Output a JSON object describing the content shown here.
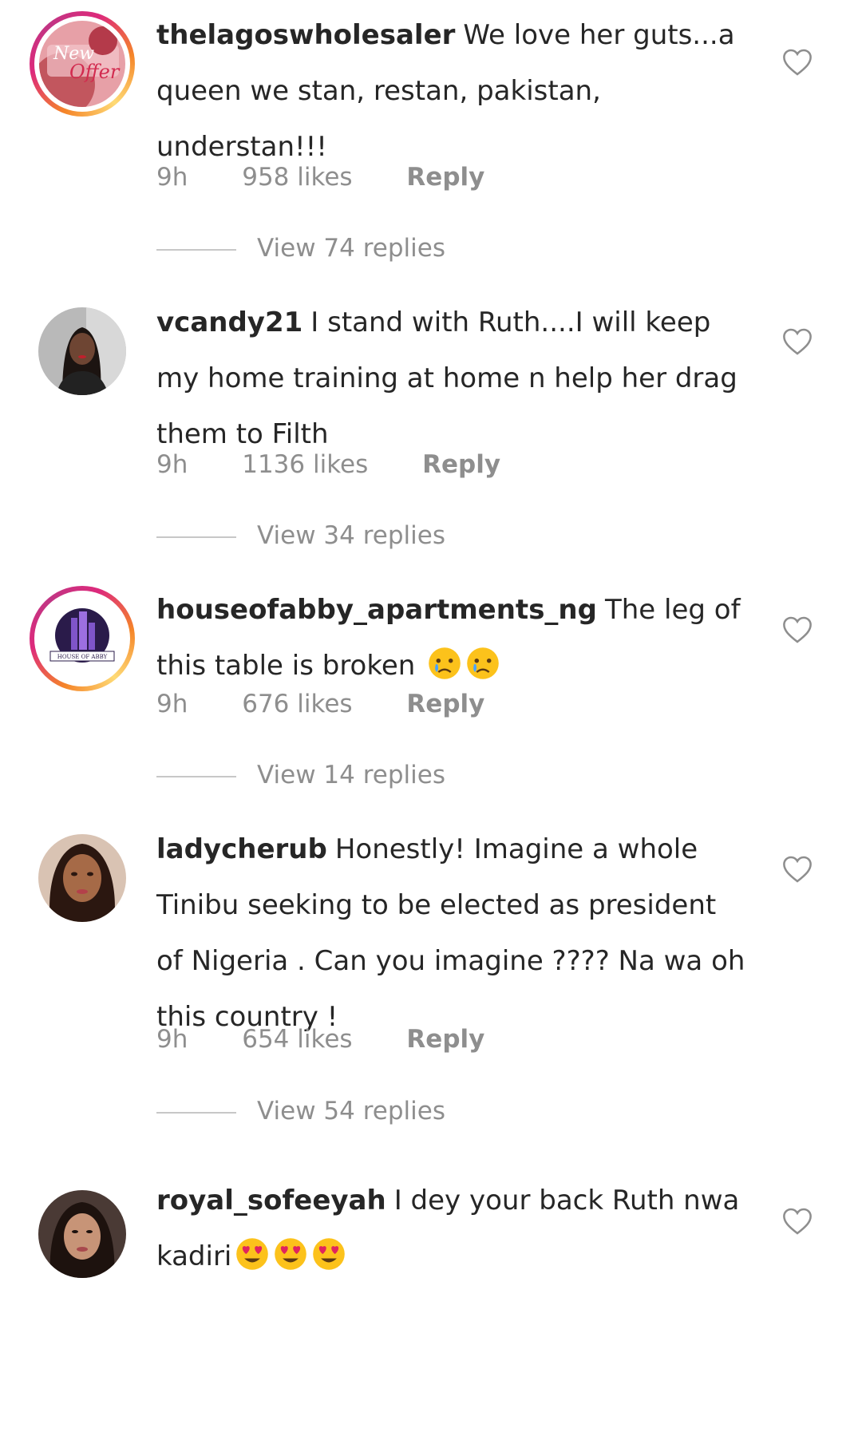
{
  "comments": [
    {
      "username": "thelagoswholesaler",
      "text": "We love her guts...a queen we stan, restan, pakistan, understan!!!",
      "time": "9h",
      "likes": "958 likes",
      "reply": "Reply",
      "view_replies": "View 74 replies"
    },
    {
      "username": "vcandy21",
      "text": "I stand with Ruth....I will keep my home training at home n help her drag them to Filth",
      "time": "9h",
      "likes": "1136 likes",
      "reply": "Reply",
      "view_replies": "View 34 replies"
    },
    {
      "username": "houseofabby_apartments_ng",
      "text": "The leg of this table is broken",
      "emoji": "crying-face",
      "time": "9h",
      "likes": "676 likes",
      "reply": "Reply",
      "view_replies": "View 14 replies",
      "avatar_logo_text": "HOUSE OF ABBY"
    },
    {
      "username": "ladycherub",
      "text": "Honestly! Imagine a whole Tinibu seeking to be elected as president of Nigeria . Can you imagine ???? Na wa oh this country !",
      "time": "9h",
      "likes": "654 likes",
      "reply": "Reply",
      "view_replies": "View 54 replies"
    },
    {
      "username": "royal_sofeeyah",
      "text": "I dey your back Ruth nwa kadiri",
      "emoji": "heart-eyes-face"
    }
  ],
  "colors": {
    "text": "#262626",
    "secondary": "#8e8e8e",
    "divider": "#c7c7c7",
    "story_ring_start": "#f58529",
    "story_ring_end": "#dd2a7b"
  },
  "icons": [
    "heart-outline-icon",
    "crying-face-emoji",
    "heart-eyes-emoji"
  ]
}
